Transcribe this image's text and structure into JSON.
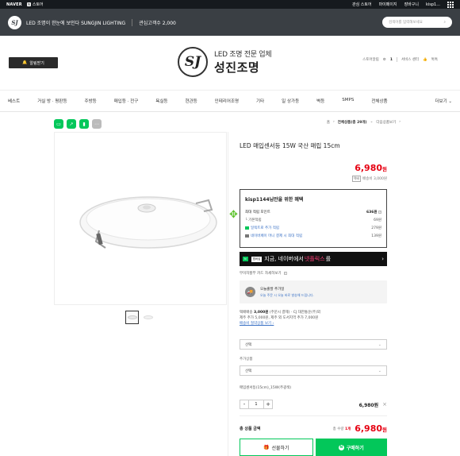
{
  "gnb": {
    "naver": "NAVER",
    "store_badge": "N",
    "store": "스토어",
    "links": [
      "관심 스토어",
      "마이페이지",
      "장바구니",
      "kisp1..."
    ],
    "apps_icon": "grid-icon"
  },
  "storebar": {
    "logo_text": "SJ",
    "name": "LED 조명이 한눈에 보인다 SUNGJIN LIGHTING",
    "fans_label": "관심고객수 2,000",
    "search_placeholder": "검색어를 입력해보세요"
  },
  "header": {
    "alarm_label": "알림받기",
    "brand_sub": "LED 조명 전문 업체",
    "brand_main": "성진조명",
    "brand_mark": "SJ",
    "links": {
      "notice": "스토어알림",
      "notice_count": "1",
      "support": "서비스 센터",
      "talk": "톡톡",
      "share": "톡",
      "talk_count": "1"
    }
  },
  "nav": {
    "items": [
      "베스트",
      "거실 방 · 평판등",
      "주방등",
      "매입등 · 전구",
      "욕실등",
      "현관등",
      "인테리어조명",
      "기타",
      "일 상가등",
      "벽등",
      "SMPS",
      "전체상품"
    ],
    "more": "더보기"
  },
  "breadcrumb": {
    "home": "홈",
    "cat": "전체상품(총 29개)",
    "next": "다음상품보기"
  },
  "product": {
    "title": "LED 매입센서등 15W 국산 매립 15cm",
    "price": "6,980",
    "won": "원",
    "shipping_tag": "택배",
    "shipping": "배송비 3,000원",
    "benefit": {
      "title": "kisp1144님만을 위한 혜택",
      "max_points_label": "최대 적립 포인트",
      "max_points": "636원",
      "rows": [
        {
          "label": "기본적립",
          "value": "69원"
        },
        {
          "label": "일렉트로 추가 적립",
          "value": "279원"
        },
        {
          "label": "네이버페이 머니 결제 시 최대 적립",
          "value": "139원"
        }
      ]
    },
    "banner": {
      "badge1": "N",
      "badge2": "멤버십",
      "text_pre": "지금, 네이버에서",
      "text_hl": "넷플릭스",
      "text_post": "를",
      "arrow": "›"
    },
    "pay_info": "무이자할부  카드 자세히보기",
    "coupon": {
      "line1": "오늘출발 추가일",
      "line2": "오늘 주문 시 오늘 바로 발송해 드립니다."
    },
    "delivery": {
      "line1_label": "택배배송",
      "line1_value": "3,000원",
      "line1_rest": "(주문시 결제) · CJ 대한통운(주)외",
      "line2": "제주 추가 5,000원, 제주 외 도서지역 추가 7,000원",
      "link": "배송비 절약상품 보기 ›"
    }
  },
  "options": {
    "select1": "선택",
    "add_label": "추가상품",
    "select2": "선택"
  },
  "selected_item": {
    "name": "매입센서등(15cm)_15W(주광색)",
    "qty": "1",
    "price": "6,980원",
    "minus": "-",
    "plus": "+",
    "remove": "×"
  },
  "total": {
    "label": "총 상품 금액",
    "count_label": "총 수량",
    "count": "1개",
    "amount": "6,980",
    "won": "원"
  },
  "actions": {
    "gift": "선물하기",
    "buy": "구매하기"
  },
  "colors": {
    "naver_green": "#03c75a",
    "price_red": "#e60012",
    "dark_bar": "#3a3f44"
  }
}
